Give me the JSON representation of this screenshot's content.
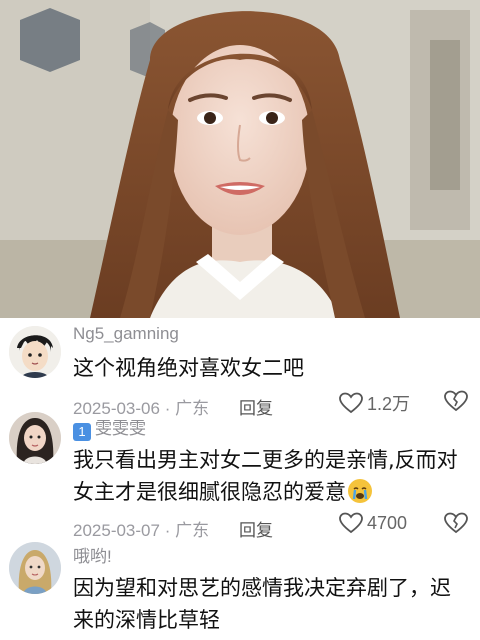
{
  "comments": [
    {
      "username": "Ng5_gamning",
      "text": "这个视角绝对喜欢女二吧",
      "date": "2025-03-06",
      "location": "广东",
      "reply_label": "回复",
      "likes": "1.2万"
    },
    {
      "rank_badge": "1",
      "username": "雯雯雯",
      "text_line1": "我只看出男主对女二更多的是亲情,反而对",
      "text_line2": "女主才是很细腻很隐忍的爱意",
      "emoji": "crying-face",
      "date": "2025-03-07",
      "location": "广东",
      "reply_label": "回复",
      "likes": "4700"
    },
    {
      "username": "哦哟!",
      "text_line1": "因为望和对思艺的感情我决定弃剧了，迟",
      "text_line2": "来的深情比草轻"
    }
  ],
  "icons": {
    "like": "heart-outline-icon",
    "dislike": "broken-heart-icon"
  },
  "colors": {
    "username": "#8e8e93",
    "meta": "#9a9aa0",
    "rank_badge": "#4a90e2"
  }
}
